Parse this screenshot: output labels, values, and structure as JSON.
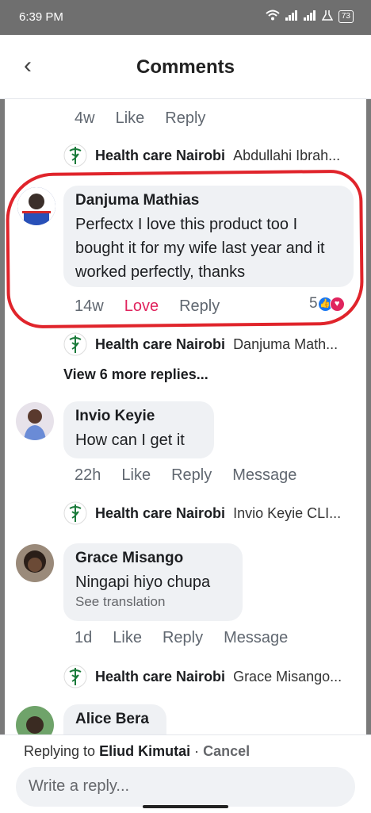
{
  "status_bar": {
    "time": "6:39 PM",
    "battery": "73"
  },
  "header": {
    "title": "Comments",
    "back_glyph": "‹"
  },
  "top_meta": {
    "time": "4w",
    "like": "Like",
    "reply": "Reply"
  },
  "reply_1": {
    "page": "Health care Nairobi",
    "snippet": "Abdullahi Ibrah..."
  },
  "comment_1": {
    "author": "Danjuma Mathias",
    "text": "Perfectx I love this product too I bought it for my wife last year and it worked perfectly, thanks",
    "time": "14w",
    "reaction_label": "Love",
    "reply": "Reply",
    "reaction_count": "5"
  },
  "reply_2": {
    "page": "Health care Nairobi",
    "snippet": "Danjuma Math..."
  },
  "view_more": "View 6 more replies...",
  "comment_2": {
    "author": "Invio Keyie",
    "text": "How can I get it",
    "time": "22h",
    "like": "Like",
    "reply": "Reply",
    "message": "Message"
  },
  "reply_3": {
    "page": "Health care Nairobi",
    "snippet": "Invio Keyie CLI..."
  },
  "comment_3": {
    "author": "Grace Misango",
    "text": "Ningapi hiyo chupa",
    "translate": "See translation",
    "time": "1d",
    "like": "Like",
    "reply": "Reply",
    "message": "Message"
  },
  "reply_4": {
    "page": "Health care Nairobi",
    "snippet": "Grace Misango..."
  },
  "comment_4": {
    "author": "Alice Bera"
  },
  "footer": {
    "replying_prefix": "Replying to",
    "replying_name": "Eliud Kimutai",
    "separator": "·",
    "cancel": "Cancel",
    "placeholder": "Write a reply..."
  },
  "colors": {
    "highlight": "#e0242b",
    "love": "#e0245e",
    "like_blue": "#1877f2"
  }
}
